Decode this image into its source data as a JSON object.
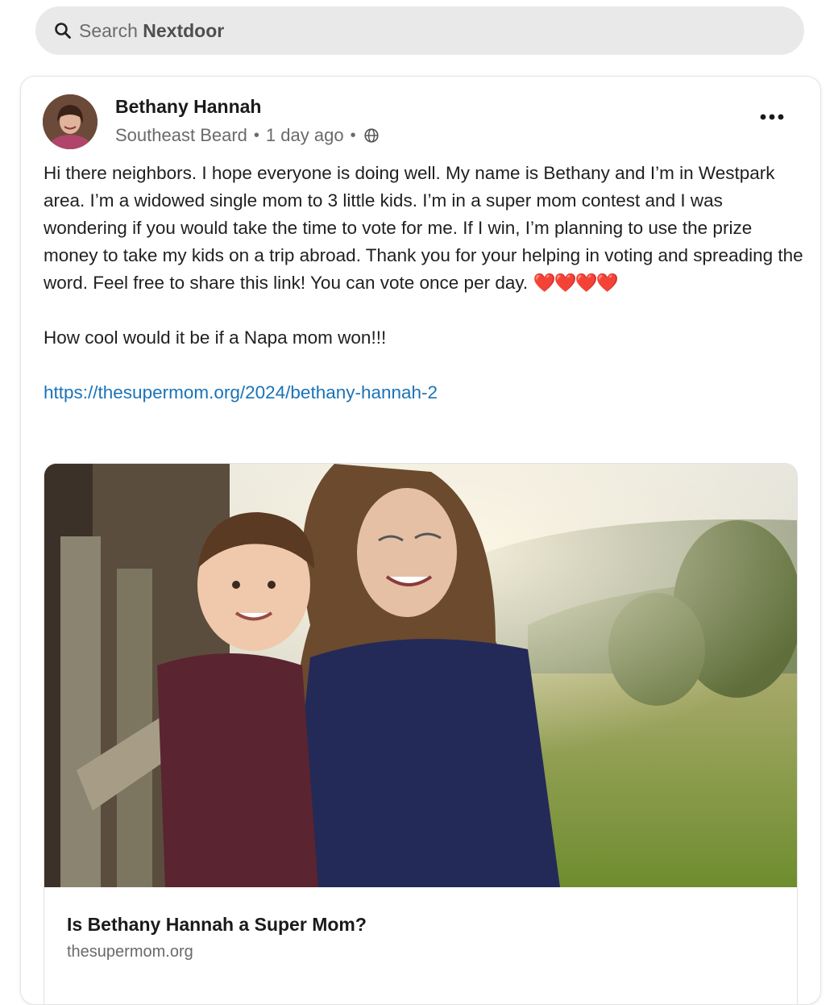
{
  "search": {
    "prefix": "Search ",
    "brand": "Nextdoor"
  },
  "post": {
    "author": "Bethany Hannah",
    "neighborhood": "Southeast Beard",
    "timestamp": "1 day ago",
    "visibility_icon": "globe-icon",
    "more_icon": "ellipsis-icon",
    "paragraphs": [
      "Hi there neighbors. I hope everyone is doing well. My name is Bethany and I’m in Westpark area. I’m a widowed single mom to 3 little kids. I’m in a super mom contest and I was wondering if you would take the time to vote for me. If I win, I’m planning to use the prize money to take my kids on a trip abroad. Thank you for your helping in voting and spreading the word. Feel free to share this link! You can vote once per day.",
      "How cool would it be if a Napa mom won!!!"
    ],
    "hearts": "❤️❤️❤️❤️",
    "link": "https://thesupermom.org/2024/bethany-hannah-2"
  },
  "preview": {
    "title": "Is Bethany Hannah a Super Mom?",
    "domain": "thesupermom.org"
  },
  "colors": {
    "link": "#1a73b8",
    "search_bg": "#e9e9e9",
    "meta_text": "#6a6a6a"
  }
}
